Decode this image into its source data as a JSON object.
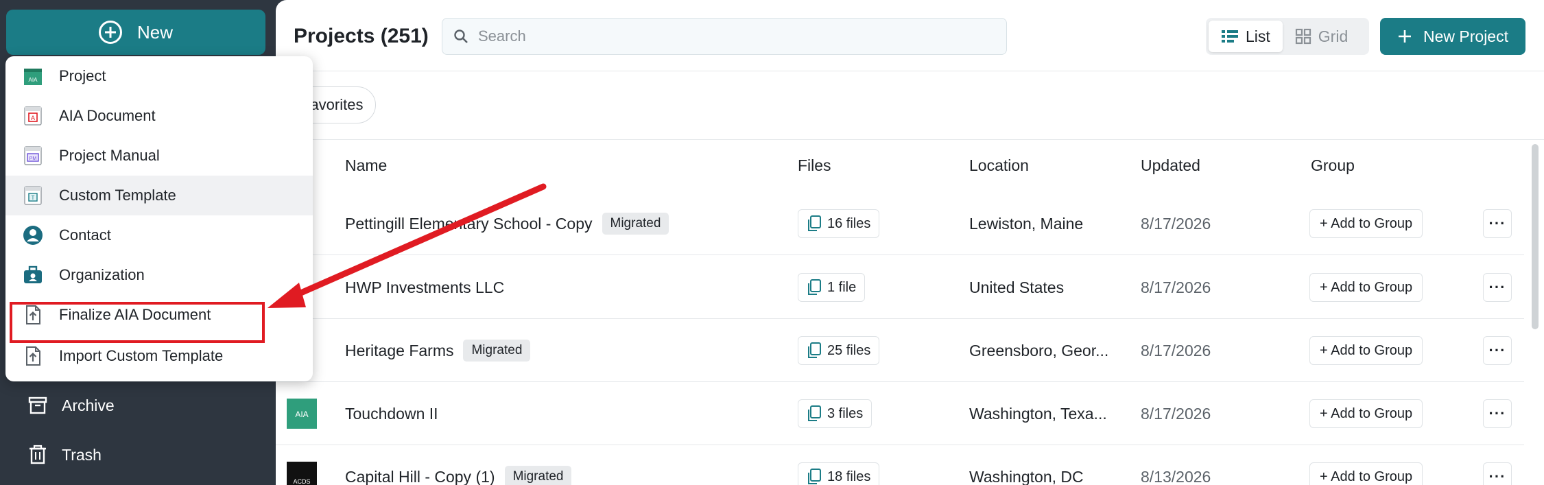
{
  "sidebar": {
    "new_label": "New",
    "archive_label": "Archive",
    "trash_label": "Trash"
  },
  "new_menu": {
    "items": [
      {
        "label": "Project",
        "icon": "aia-project-icon"
      },
      {
        "label": "AIA Document",
        "icon": "aia-document-icon"
      },
      {
        "label": "Project Manual",
        "icon": "project-manual-icon"
      },
      {
        "label": "Custom Template",
        "icon": "custom-template-icon"
      },
      {
        "label": "Contact",
        "icon": "contact-icon"
      },
      {
        "label": "Organization",
        "icon": "organization-icon"
      },
      {
        "label": "Finalize AIA Document",
        "icon": "upload-file-icon"
      },
      {
        "label": "Import Custom Template",
        "icon": "upload-file-icon"
      }
    ],
    "highlighted": "Finalize AIA Document"
  },
  "header": {
    "title": "Projects (251)",
    "search_placeholder": "Search",
    "view_list": "List",
    "view_grid": "Grid",
    "active_view": "List",
    "new_project_label": "New Project"
  },
  "filters": {
    "favorites": "Favorites"
  },
  "table": {
    "columns": [
      "Name",
      "Files",
      "Location",
      "Updated",
      "Group"
    ],
    "add_to_group_label": "+ Add to Group",
    "rows": [
      {
        "name": "Pettingill Elementary School - Copy",
        "badge": "Migrated",
        "files": "16 files",
        "location": "Lewiston, Maine",
        "updated": "8/17/2026"
      },
      {
        "name": "HWP Investments LLC",
        "badge": "",
        "files": "1 file",
        "location": "United States",
        "updated": "8/17/2026"
      },
      {
        "name": "Heritage Farms",
        "badge": "Migrated",
        "files": "25 files",
        "location": "Greensboro, Geor...",
        "updated": "8/17/2026"
      },
      {
        "name": "Touchdown II",
        "badge": "",
        "files": "3 files",
        "location": "Washington, Texa...",
        "updated": "8/17/2026",
        "thumb_label": "AIA"
      },
      {
        "name": "Capital Hill - Copy (1)",
        "badge": "Migrated",
        "files": "18 files",
        "location": "Washington, DC",
        "updated": "8/13/2026",
        "thumb_label": "ACDS"
      }
    ]
  },
  "colors": {
    "accent": "#1b7c86",
    "sidebar_bg": "#2e3640",
    "annotation_red": "#e01b22",
    "aia_green": "#2f9e7c"
  }
}
